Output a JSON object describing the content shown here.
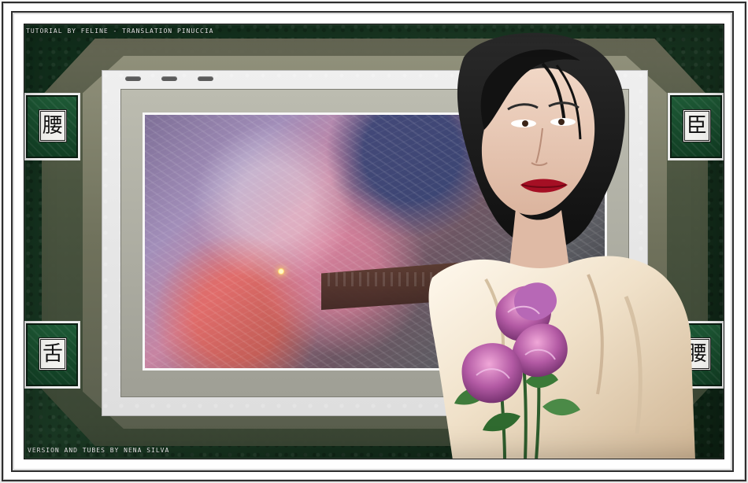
{
  "captions": {
    "top": "TUTORIAL BY FELINE - TRANSLATION PINUCCIA",
    "bottom": "VERSION AND TUBES BY NENA SILVA"
  },
  "tiles": {
    "top_left": "腰",
    "bottom_left": "舌",
    "top_right": "臣",
    "bottom_right": "腰"
  },
  "colors": {
    "panel_green": "#1a3823",
    "frame_white": "#ffffff",
    "accent_gray": "#9f9f95"
  }
}
